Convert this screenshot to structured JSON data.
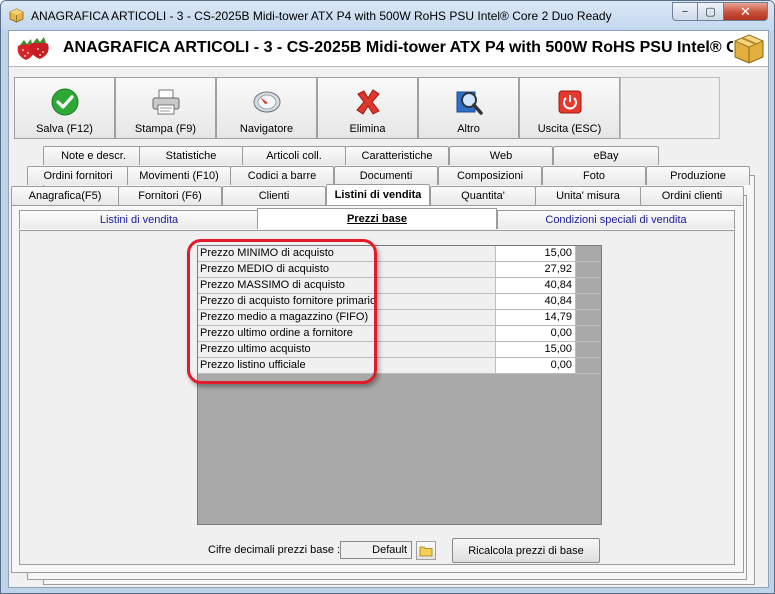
{
  "window": {
    "title": "ANAGRAFICA ARTICOLI - 3 - CS-2025B Midi-tower ATX P4 with 500W RoHS PSU Intel® Core 2 Duo Ready",
    "header": "ANAGRAFICA ARTICOLI - 3 - CS-2025B Midi-tower ATX P4 with 500W RoHS PSU Intel® C",
    "controls": {
      "minimize": "−",
      "maximize": "▢",
      "close": "✕"
    }
  },
  "toolbar": {
    "save": "Salva (F12)",
    "print": "Stampa (F9)",
    "navigator": "Navigatore",
    "delete": "Elimina",
    "other": "Altro",
    "exit": "Uscita (ESC)"
  },
  "tabs": {
    "row1": [
      "Note e descr.",
      "Statistiche",
      "Articoli coll.",
      "Caratteristiche",
      "Web",
      "eBay"
    ],
    "row2": [
      "Ordini fornitori",
      "Movimenti (F10)",
      "Codici a barre",
      "Documenti",
      "Composizioni",
      "Foto",
      "Produzione"
    ],
    "row3": [
      "Anagrafica(F5)",
      "Fornitori (F6)",
      "Clienti",
      "Listini di vendita",
      "Quantita'",
      "Unita' misura",
      "Ordini clienti"
    ]
  },
  "subtabs": [
    "Listini di vendita",
    "Prezzi base",
    "Condizioni speciali di vendita"
  ],
  "prices": [
    {
      "label": "Prezzo MINIMO di acquisto",
      "value": "15,00"
    },
    {
      "label": "Prezzo MEDIO di acquisto",
      "value": "27,92"
    },
    {
      "label": "Prezzo MASSIMO di acquisto",
      "value": "40,84"
    },
    {
      "label": "Prezzo di acquisto fornitore primario",
      "value": "40,84"
    },
    {
      "label": "Prezzo medio a magazzino (FIFO)",
      "value": "14,79"
    },
    {
      "label": "Prezzo ultimo ordine a fornitore",
      "value": "0,00"
    },
    {
      "label": "Prezzo ultimo acquisto",
      "value": "15,00"
    },
    {
      "label": "Prezzo listino ufficiale",
      "value": "0,00"
    }
  ],
  "footer": {
    "decimals_label": "Cifre decimali prezzi base :",
    "decimals_value": "Default",
    "recalc_button": "Ricalcola prezzi di base"
  },
  "colors": {
    "highlight": "#e21b2a",
    "subtab_text": "#1a1a9a",
    "title_bar": "#c3d7ee"
  }
}
